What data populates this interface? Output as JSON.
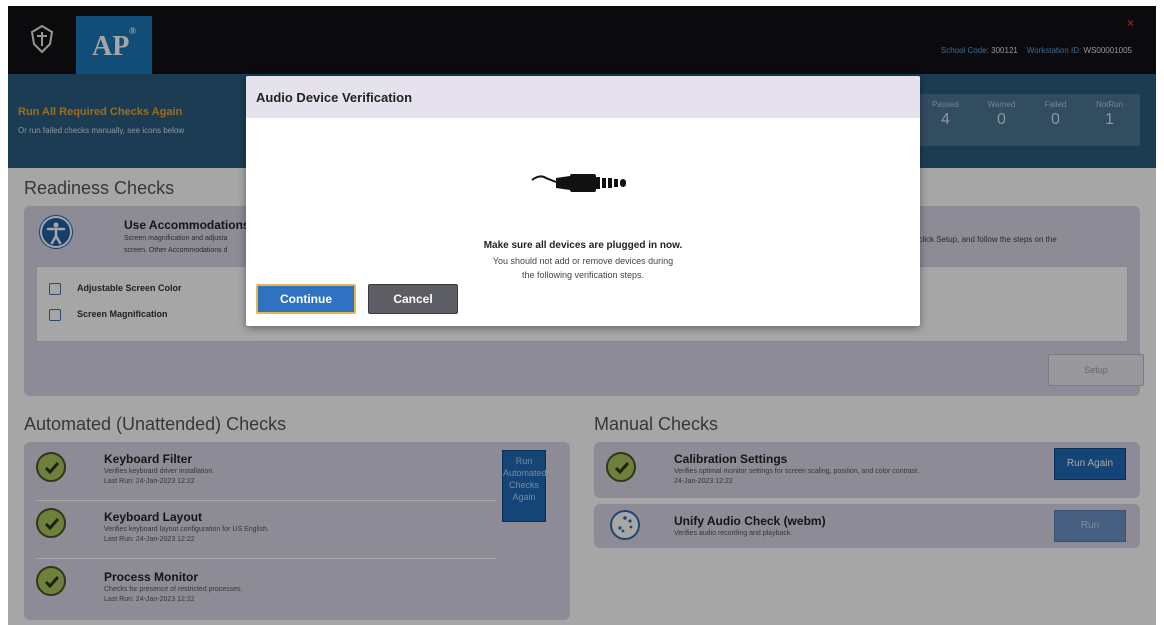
{
  "header": {
    "logo_text": "AP",
    "logo_mark": "®",
    "close_symbol": "×",
    "school_code_label": "School Code:",
    "school_code": "300121",
    "workstation_label": "Workstation ID:",
    "workstation_id": "WS00001005"
  },
  "banner": {
    "title": "Run All Required Checks Again",
    "subtitle": "Or run failed checks manually, see icons below",
    "counts": [
      {
        "label": "Passed",
        "value": "4"
      },
      {
        "label": "Warned",
        "value": "0"
      },
      {
        "label": "Failed",
        "value": "0"
      },
      {
        "label": "NotRun",
        "value": "1"
      }
    ]
  },
  "readiness": {
    "title": "Readiness Checks",
    "accommodations": {
      "title": "Use Accommodations",
      "desc_line1": "Screen magnification and adjusta",
      "desc_line2": "screen. Other Accommodations d",
      "desc_right": ", click Setup, and follow the steps on the"
    },
    "options": [
      {
        "label": "Adjustable Screen Color"
      },
      {
        "label": "Screen Magnification"
      }
    ],
    "setup_label": "Setup"
  },
  "automated": {
    "title": "Automated (Unattended) Checks",
    "run_button": [
      "Run",
      "Automated",
      "Checks",
      "Again"
    ],
    "items": [
      {
        "title": "Keyboard Filter",
        "desc": "Verifies keyboard driver installation.",
        "date": "Last Run: 24-Jan-2023 12:22"
      },
      {
        "title": "Keyboard Layout",
        "desc": "Verifies keyboard layout configuration for US English.",
        "date": "Last Run: 24-Jan-2023 12:22"
      },
      {
        "title": "Process Monitor",
        "desc": "Checks for presence of restricted processes.",
        "date": "Last Run: 24-Jan-2023 12:22"
      }
    ]
  },
  "manual": {
    "title": "Manual Checks",
    "items": [
      {
        "title": "Calibration Settings",
        "desc": "Verifies optimal monitor settings for screen scaling, position, and color contrast.",
        "date": "24-Jan-2023 12:22",
        "button": "Run Again"
      },
      {
        "title": "Unify Audio Check (webm)",
        "desc": "Verifies audio recording and playback.",
        "button": "Run"
      }
    ]
  },
  "modal": {
    "title": "Audio Device Verification",
    "message_bold": "Make sure all devices are plugged in now.",
    "message_line2": "You should not add or remove devices during",
    "message_line3": "the following verification steps.",
    "continue_label": "Continue",
    "cancel_label": "Cancel"
  },
  "colors": {
    "header_bg": "#111115",
    "banner_bg": "#2a5d80",
    "banner_title": "#f2a72b",
    "panel_bg": "#d9d6e5",
    "primary_button": "#2f72c2",
    "check_green": "#a9c55c"
  }
}
